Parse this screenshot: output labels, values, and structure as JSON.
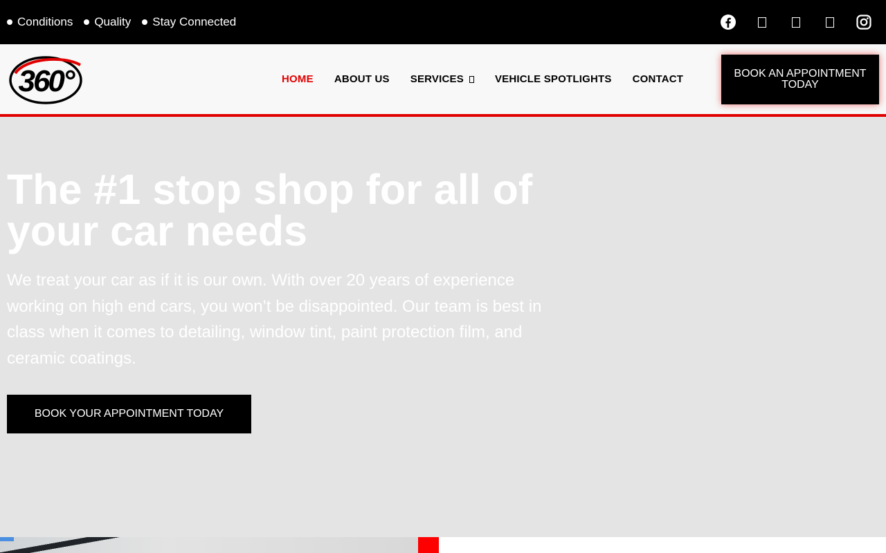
{
  "topbar": {
    "links": [
      "Conditions",
      "Quality",
      "Stay Connected"
    ],
    "socials": [
      "facebook-icon",
      "social-icon-2",
      "social-icon-3",
      "social-icon-4",
      "instagram-icon"
    ]
  },
  "header": {
    "logo_text": "360°",
    "nav": [
      {
        "label": "HOME",
        "active": true
      },
      {
        "label": "ABOUT US"
      },
      {
        "label": "SERVICES",
        "has_dropdown": true
      },
      {
        "label": "VEHICLE SPOTLIGHTS"
      },
      {
        "label": "CONTACT"
      }
    ],
    "cta_label": "BOOK AN APPOINTMENT TODAY"
  },
  "hero": {
    "title": "The #1 stop shop for all of your car needs",
    "text": "We treat your car as if it is our own. With over 20 years of experience working on high end cars, you won’t be disappointed. Our team is best in class when it comes to detailing, window tint, paint protection film, and ceramic coatings.",
    "button_label": "BOOK YOUR APPOINTMENT TODAY"
  },
  "colors": {
    "accent": "#e10000",
    "topbar_bg": "#000000",
    "hero_bg": "#e4e4e4"
  }
}
